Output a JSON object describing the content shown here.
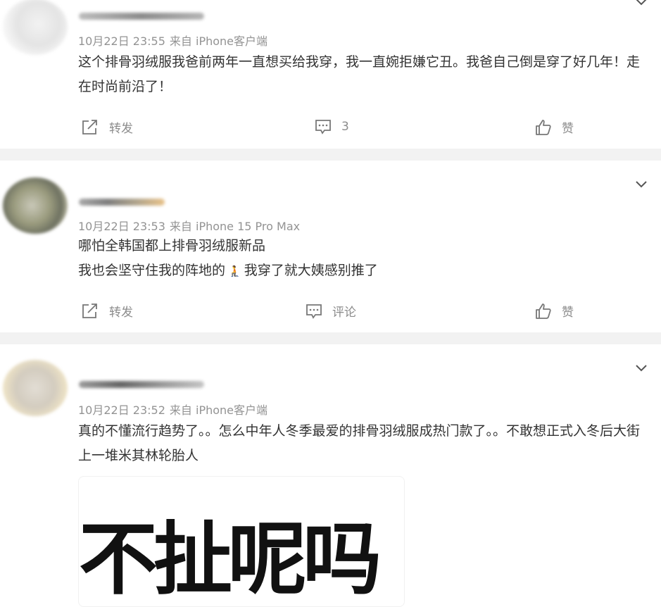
{
  "comments": [
    {
      "meta_date": "10月22日 23:55",
      "meta_source": "来自 iPhone客户端",
      "text_lines": [
        "这个排骨羽绒服我爸前两年一直想买给我穿，我一直婉拒嫌它丑。我爸自己倒是穿了好几年！走在时尚前沿了！"
      ],
      "forward_label": "转发",
      "comment_label": "3",
      "like_label": "赞"
    },
    {
      "meta_date": "10月22日 23:53",
      "meta_source": "来自 iPhone 15 Pro Max",
      "text_lines": [
        "哪怕全韩国都上排骨羽绒服新品",
        "我也会坚守住我的阵地的",
        "我穿了就大姨感别推了"
      ],
      "emoji": "🧎",
      "forward_label": "转发",
      "comment_label": "评论",
      "like_label": "赞"
    },
    {
      "meta_date": "10月22日 23:52",
      "meta_source": "来自 iPhone客户端",
      "text_lines": [
        "真的不懂流行趋势了。。怎么中年人冬季最爱的排骨羽绒服成热门款了。。不敢想正式入冬后大街上一堆米其林轮胎人"
      ],
      "image_text": "不扯呢吗"
    }
  ],
  "icons": {
    "chevron": "chevron-down-icon",
    "forward": "share-icon",
    "comment": "comment-icon",
    "like": "thumbs-up-icon"
  },
  "colors": {
    "background": "#ffffff",
    "separator": "#f2f2f2",
    "meta": "#939393",
    "text": "#333333",
    "action": "#8c8c8c"
  }
}
